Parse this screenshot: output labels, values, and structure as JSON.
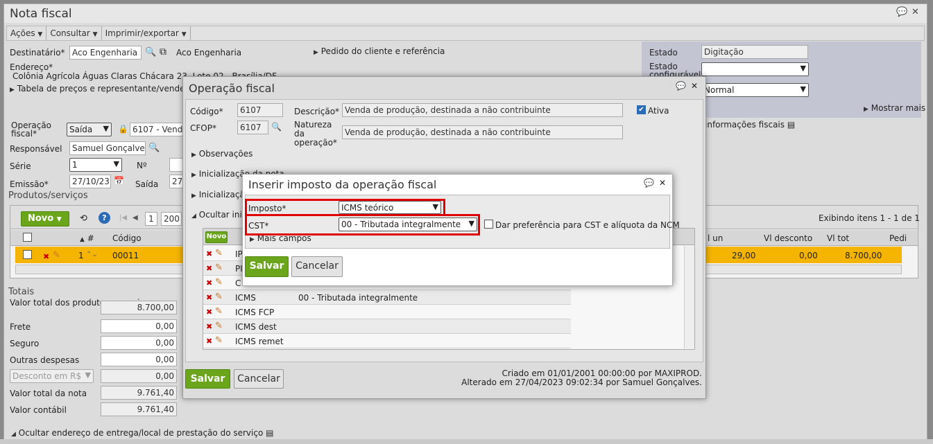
{
  "window": {
    "title": "Nota fiscal",
    "comment_icon": "comment-icon",
    "close_icon": "close-icon"
  },
  "menu": {
    "items": [
      "Ações",
      "Consultar",
      "Imprimir/exportar"
    ]
  },
  "header": {
    "destinatario_label": "Destinatário*",
    "destinatario_value": "Aco Engenharia",
    "destinatario_link": "Aco Engenharia",
    "endereco_label": "Endereço*",
    "endereco_value": "Colônia Agrícola Águas Claras Chácara 23, Lote 02 - Brasília/DF",
    "tabela_link": "Tabela de preços e representante/vendedor",
    "pedido_link": "Pedido do cliente e referência",
    "estado_label": "Estado",
    "estado_value": "Digitação",
    "estado_config_label": "Estado configurável",
    "tipo_value": "Normal",
    "mostrar_mais": "Mostrar mais",
    "info_fiscais": "informações fiscais",
    "operacao_label": "Operação fiscal*",
    "operacao_tipo": "Saída",
    "operacao_value": "6107 - Venda",
    "responsavel_label": "Responsável",
    "responsavel_value": "Samuel Gonçalves",
    "serie_label": "Série",
    "serie_value": "1",
    "numero_label": "Nº",
    "emissao_label": "Emissão*",
    "emissao_value": "27/10/23",
    "saida_label": "Saída",
    "saida_value": "27/"
  },
  "produtos": {
    "title": "Produtos/serviços",
    "novo": "Novo",
    "page": "1",
    "page_size": "200",
    "exibindo": "Exibindo itens 1 - 1 de 1",
    "columns": [
      "#",
      "Código",
      "l un",
      "Vl desconto",
      "Vl tot",
      "Pedi"
    ],
    "row": {
      "num": "1",
      "codigo": "00011",
      "vl_un": "29,00",
      "vl_desc": "0,00",
      "vl_tot": "8.700,00"
    }
  },
  "totais": {
    "title": "Totais",
    "items": [
      {
        "label": "Valor total dos produtos e serviços",
        "value": "8.700,00"
      },
      {
        "label": "Frete",
        "value": "0,00"
      },
      {
        "label": "Seguro",
        "value": "0,00"
      },
      {
        "label": "Outras despesas",
        "value": "0,00"
      },
      {
        "label": "Desconto em R$",
        "value": "0,00"
      },
      {
        "label": "Valor total da nota",
        "value": "9.761,40"
      },
      {
        "label": "Valor contábil",
        "value": "9.761,40"
      }
    ],
    "ocultar": "Ocultar endereço de entrega/local de prestação do serviço"
  },
  "operacao_modal": {
    "title": "Operação fiscal",
    "codigo_label": "Código*",
    "codigo_value": "6107",
    "cfop_label": "CFOP*",
    "cfop_value": "6107",
    "descricao_label": "Descrição*",
    "descricao_value": "Venda de produção, destinada a não contribuinte",
    "natureza_label": "Natureza da operação*",
    "natureza_value": "Venda de produção, destinada a não contribuinte",
    "ativa_label": "Ativa",
    "observacoes": "Observações",
    "inicializacao1": "Inicialização da nota",
    "inicializacao2": "Inicializaçã",
    "ocultar": "Ocultar inic",
    "novo": "Novo",
    "imposto_rows": [
      {
        "name": "IP",
        "cst": ""
      },
      {
        "name": "PI",
        "cst": ""
      },
      {
        "name": "C",
        "cst": ""
      },
      {
        "name": "ICMS",
        "cst": "00 - Tributada integralmente"
      },
      {
        "name": "ICMS FCP",
        "cst": ""
      },
      {
        "name": "ICMS dest",
        "cst": ""
      },
      {
        "name": "ICMS remet",
        "cst": ""
      }
    ],
    "salvar": "Salvar",
    "cancelar": "Cancelar",
    "criado": "Criado em 01/01/2001 00:00:00 por MAXIPROD.",
    "alterado": "Alterado em 27/04/2023 09:02:34 por Samuel Gonçalves."
  },
  "inserir_modal": {
    "title": "Inserir imposto da operação fiscal",
    "imposto_label": "Imposto*",
    "imposto_value": "ICMS teórico",
    "cst_label": "CST*",
    "cst_value": "00 - Tributada integralmente",
    "preferencia_label": "Dar preferência para CST e alíquota da NCM",
    "mais_campos": "Mais campos",
    "salvar": "Salvar",
    "cancelar": "Cancelar"
  },
  "colors": {
    "accent_green": "#6aa51c",
    "highlight_row": "#f5b400",
    "red_frame": "#e00000"
  }
}
